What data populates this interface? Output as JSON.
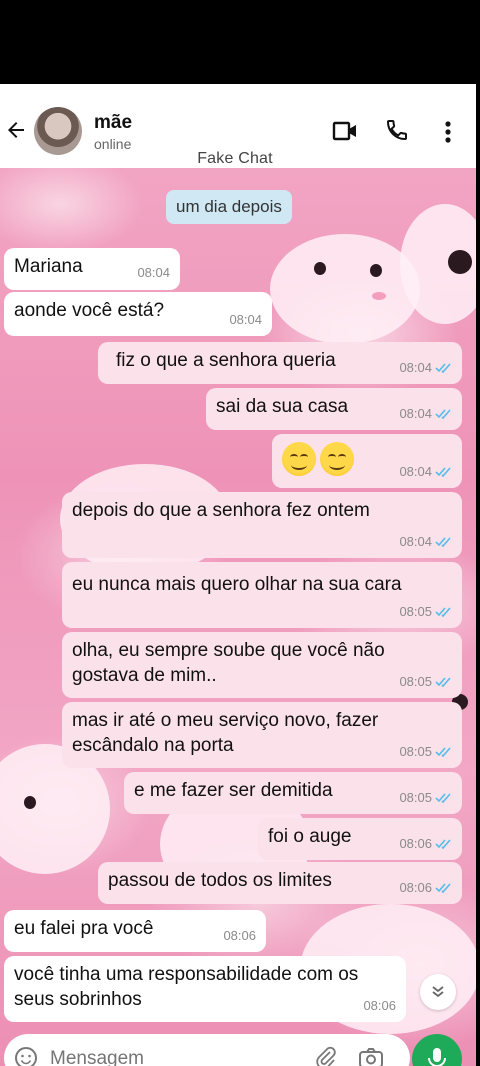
{
  "header": {
    "contact_name": "mãe",
    "contact_status": "online",
    "subtitle": "Fake Chat"
  },
  "date_chip": "um dia depois",
  "messages": [
    {
      "text": "Mariana",
      "time": "08:04",
      "direction": "in"
    },
    {
      "text": "aonde você está?",
      "time": "08:04",
      "direction": "in"
    },
    {
      "text": "fiz o que a senhora queria",
      "time": "08:04",
      "direction": "out",
      "read": true
    },
    {
      "text": "sai da sua casa",
      "time": "08:04",
      "direction": "out",
      "read": true
    },
    {
      "text": "😊😊",
      "time": "08:04",
      "direction": "out",
      "read": true
    },
    {
      "text": "depois do que a senhora fez ontem",
      "time": "08:04",
      "direction": "out",
      "read": true
    },
    {
      "text": "eu nunca mais quero olhar na sua cara",
      "time": "08:05",
      "direction": "out",
      "read": true
    },
    {
      "text": "olha, eu sempre soube que você não gostava de mim..",
      "time": "08:05",
      "direction": "out",
      "read": true
    },
    {
      "text": "mas ir até o meu serviço novo, fazer escândalo na porta",
      "time": "08:05",
      "direction": "out",
      "read": true
    },
    {
      "text": "e me fazer ser demitida",
      "time": "08:05",
      "direction": "out",
      "read": true
    },
    {
      "text": "foi o auge",
      "time": "08:06",
      "direction": "out",
      "read": true
    },
    {
      "text": "passou de todos os limites",
      "time": "08:06",
      "direction": "out",
      "read": true
    },
    {
      "text": "eu falei pra você",
      "time": "08:06",
      "direction": "in"
    },
    {
      "text": "você tinha uma responsabilidade com os seus sobrinhos",
      "time": "08:06",
      "direction": "in"
    }
  ],
  "input": {
    "placeholder": "Mensagem"
  },
  "colors": {
    "incoming_bubble": "#ffffff",
    "outgoing_bubble": "#fbe1ea",
    "read_ticks": "#53bdeb",
    "mic_button": "#1faa59"
  },
  "icons": [
    "back-arrow-icon",
    "video-call-icon",
    "phone-icon",
    "more-options-icon",
    "emoji-icon",
    "attach-icon",
    "camera-icon",
    "mic-icon",
    "double-chevron-down-icon"
  ]
}
